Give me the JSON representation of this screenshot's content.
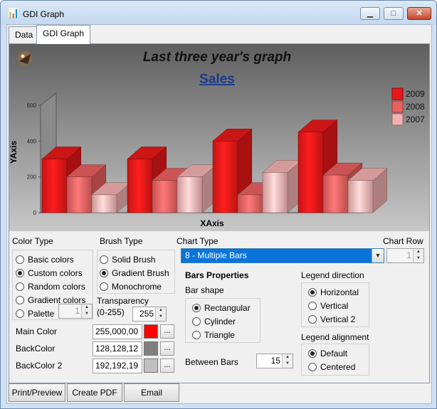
{
  "window": {
    "title": "GDI Graph",
    "minimize": "▁",
    "maximize": "□",
    "close": "✕"
  },
  "tabs": [
    {
      "label": "Data"
    },
    {
      "label": "GDI Graph"
    }
  ],
  "chart_data": {
    "type": "bar",
    "title": "Last three year's graph",
    "subtitle": "Sales",
    "xlabel": "XAxis",
    "ylabel": "YAxis",
    "categories": [
      "",
      "",
      "",
      ""
    ],
    "yticks": [
      "0",
      "200",
      "400",
      "600"
    ],
    "ylim": [
      0,
      600
    ],
    "series": [
      {
        "name": "2009",
        "color": "#e81818",
        "values": [
          300,
          300,
          400,
          450
        ]
      },
      {
        "name": "2008",
        "color": "#e86060",
        "values": [
          200,
          180,
          100,
          210
        ]
      },
      {
        "name": "2007",
        "color": "#f2b0b0",
        "values": [
          100,
          200,
          225,
          180
        ]
      }
    ],
    "grid": false,
    "legend": "top-right"
  },
  "color_type": {
    "label": "Color Type",
    "options": [
      {
        "label": "Basic colors",
        "selected": false
      },
      {
        "label": "Custom colors",
        "selected": true
      },
      {
        "label": "Random colors",
        "selected": false
      },
      {
        "label": "Gradient colors",
        "selected": false
      },
      {
        "label": "Palette",
        "selected": false
      }
    ],
    "palette_value": "1"
  },
  "brush_type": {
    "label": "Brush Type",
    "options": [
      {
        "label": "Solid Brush",
        "selected": false
      },
      {
        "label": "Gradient Brush",
        "selected": true
      },
      {
        "label": "Monochrome",
        "selected": false
      }
    ],
    "transparency_label": "Transparency",
    "transparency_range": "(0-255)",
    "transparency_value": "255"
  },
  "colors": [
    {
      "label": "Main Color",
      "value": "255,000,00",
      "swatch": "#ff0000"
    },
    {
      "label": "BackColor",
      "value": "128,128,12",
      "swatch": "#808080"
    },
    {
      "label": "BackColor 2",
      "value": "192,192,19",
      "swatch": "#c0c0c0"
    }
  ],
  "color_button_label": "...",
  "chart_type": {
    "label": "Chart Type",
    "value": "8 - Multiple Bars"
  },
  "chart_row": {
    "label": "Chart Row",
    "value": "1"
  },
  "bars_properties": {
    "title": "Bars Properties",
    "shape_label": "Bar shape",
    "shapes": [
      {
        "label": "Rectangular",
        "selected": true
      },
      {
        "label": "Cylinder",
        "selected": false
      },
      {
        "label": "Triangle",
        "selected": false
      }
    ],
    "between_label": "Between Bars",
    "between_value": "15"
  },
  "legend_direction": {
    "label": "Legend direction",
    "options": [
      {
        "label": "Horizontal",
        "selected": true
      },
      {
        "label": "Vertical",
        "selected": false
      },
      {
        "label": "Vertical 2",
        "selected": false
      }
    ]
  },
  "legend_alignment": {
    "label": "Legend alignment",
    "options": [
      {
        "label": "Default",
        "selected": true
      },
      {
        "label": "Centered",
        "selected": false
      }
    ]
  },
  "buttons": {
    "print": "Print/Preview",
    "pdf": "Create PDF",
    "email": "Email"
  }
}
